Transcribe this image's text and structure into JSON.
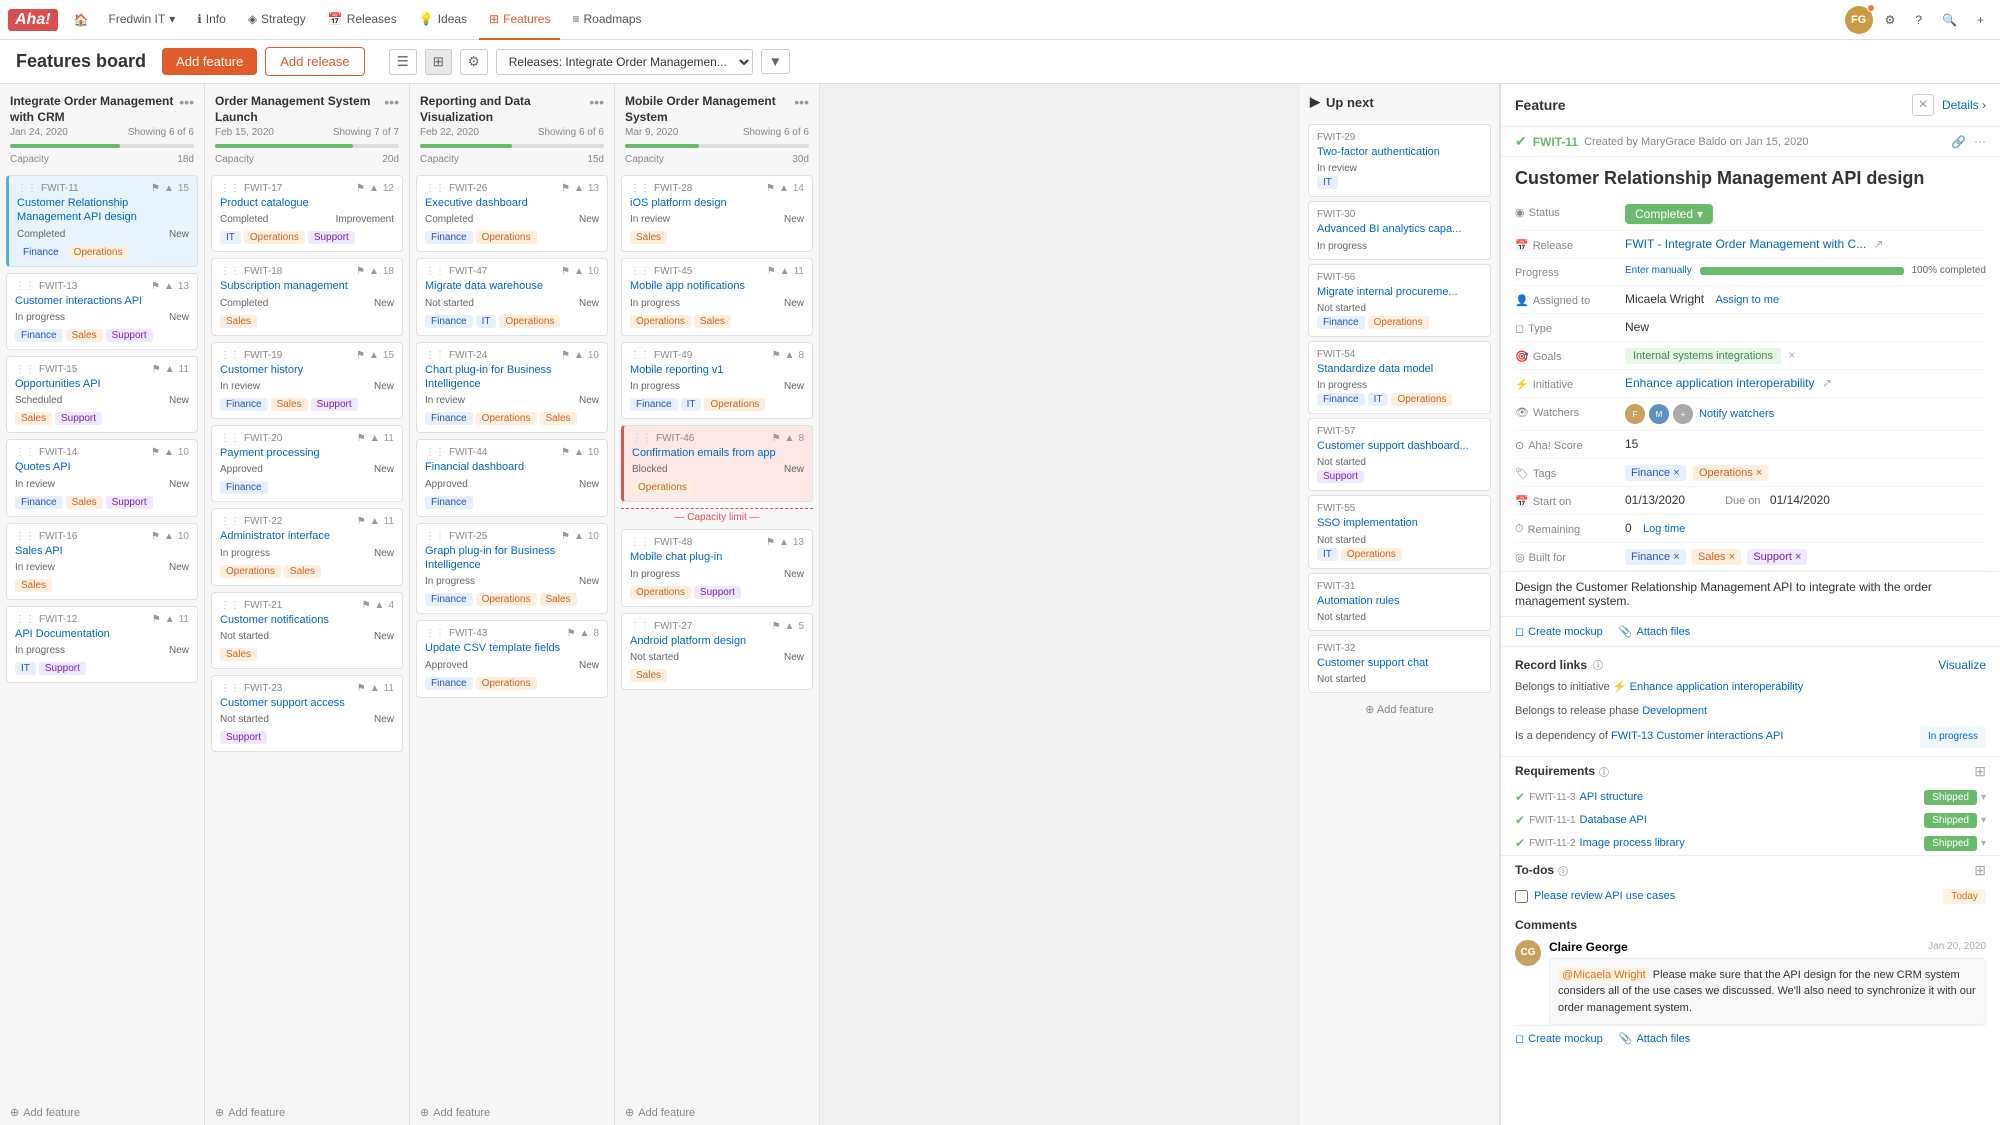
{
  "app": {
    "logo": "Aha!",
    "nav_items": [
      {
        "label": "Fredwin IT",
        "icon": "home",
        "dropdown": true
      },
      {
        "label": "Info",
        "icon": "info"
      },
      {
        "label": "Strategy",
        "icon": "strategy"
      },
      {
        "label": "Releases",
        "icon": "calendar"
      },
      {
        "label": "Ideas",
        "icon": "lightbulb"
      },
      {
        "label": "Features",
        "icon": "grid",
        "active": true
      },
      {
        "label": "Roadmaps",
        "icon": "roadmap"
      }
    ],
    "page_title": "Features board",
    "btn_add_feature": "Add feature",
    "btn_add_release": "Add release"
  },
  "filter": {
    "view_options": [
      "list",
      "grid",
      "settings"
    ],
    "release_filter": "Releases: Integrate Order Managemen...",
    "filter_icon": "filter"
  },
  "columns": [
    {
      "id": "col1",
      "title": "Integrate Order Management with CRM",
      "date": "Jan 24, 2020",
      "showing": "Showing 6 of 6",
      "capacity_label": "Capacity",
      "capacity_days": "18d",
      "progress": 60,
      "cards": [
        {
          "id": "FWIT-11",
          "title": "Customer Relationship Management API design",
          "status": "Completed",
          "status_label": "New",
          "tags": [
            "Finance",
            "Operations"
          ],
          "tag_styles": [
            "finance",
            "operations"
          ],
          "icons": "⚑▲",
          "count": 15,
          "highlighted": true
        },
        {
          "id": "FWIT-13",
          "title": "Customer interactions API",
          "status": "In progress",
          "status_label": "New",
          "tags": [
            "Finance",
            "Sales",
            "Support"
          ],
          "tag_styles": [
            "finance",
            "sales",
            "support"
          ],
          "icons": "▲",
          "count": 13
        },
        {
          "id": "FWIT-15",
          "title": "Opportunities API",
          "status": "Scheduled",
          "status_label": "New",
          "tags": [
            "Sales",
            "Support"
          ],
          "tag_styles": [
            "sales",
            "support"
          ],
          "icons": "⚑▲",
          "count": 11
        },
        {
          "id": "FWIT-14",
          "title": "Quotes API",
          "status": "In review",
          "status_label": "New",
          "tags": [
            "Finance",
            "Sales",
            "Support"
          ],
          "tag_styles": [
            "finance",
            "sales",
            "support"
          ],
          "icons": "▲",
          "count": 10
        },
        {
          "id": "FWIT-16",
          "title": "Sales API",
          "status": "In review",
          "status_label": "New",
          "tags": [
            "Sales"
          ],
          "tag_styles": [
            "sales"
          ],
          "icons": "▲",
          "count": 10
        },
        {
          "id": "FWIT-12",
          "title": "API Documentation",
          "status": "In progress",
          "status_label": "New",
          "tags": [
            "IT",
            "Support"
          ],
          "tag_styles": [
            "it",
            "support"
          ],
          "icons": "▲",
          "count": 11
        }
      ]
    },
    {
      "id": "col2",
      "title": "Order Management System Launch",
      "date": "Feb 15, 2020",
      "showing": "Showing 7 of 7",
      "capacity_label": "Capacity",
      "capacity_days": "20d",
      "progress": 75,
      "cards": [
        {
          "id": "FWIT-17",
          "title": "Product catalogue",
          "status": "Completed",
          "status_label": "Improvement",
          "tags": [
            "IT",
            "Operations",
            "Support"
          ],
          "tag_styles": [
            "it",
            "operations",
            "support"
          ],
          "icons": "▲",
          "count": 12
        },
        {
          "id": "FWIT-18",
          "title": "Subscription management",
          "status": "Completed",
          "status_label": "New",
          "tags": [
            "Sales"
          ],
          "tag_styles": [
            "sales"
          ],
          "icons": "▲",
          "count": 18
        },
        {
          "id": "FWIT-19",
          "title": "Customer history",
          "status": "In review",
          "status_label": "New",
          "tags": [
            "Finance",
            "Sales",
            "Support"
          ],
          "tag_styles": [
            "finance",
            "sales",
            "support"
          ],
          "icons": "▲",
          "count": 15
        },
        {
          "id": "FWIT-20",
          "title": "Payment processing",
          "status": "Approved",
          "status_label": "New",
          "tags": [
            "Finance"
          ],
          "tag_styles": [
            "finance"
          ],
          "icons": "▲",
          "count": 11
        },
        {
          "id": "FWIT-22",
          "title": "Administrator interface",
          "status": "In progress",
          "status_label": "New",
          "tags": [
            "Operations",
            "Sales"
          ],
          "tag_styles": [
            "operations",
            "sales"
          ],
          "icons": "▲",
          "count": 11
        },
        {
          "id": "FWIT-21",
          "title": "Customer notifications",
          "status": "Not started",
          "status_label": "New",
          "tags": [
            "Sales"
          ],
          "tag_styles": [
            "sales"
          ],
          "icons": "▲",
          "count": 4
        },
        {
          "id": "FWIT-23",
          "title": "Customer support access",
          "status": "Not started",
          "status_label": "New",
          "tags": [
            "Support"
          ],
          "tag_styles": [
            "support"
          ],
          "icons": "▲",
          "count": 11
        }
      ]
    },
    {
      "id": "col3",
      "title": "Reporting and Data Visualization",
      "date": "Feb 22, 2020",
      "showing": "Showing 6 of 6",
      "capacity_label": "Capacity",
      "capacity_days": "15d",
      "progress": 50,
      "cards": [
        {
          "id": "FWIT-26",
          "title": "Executive dashboard",
          "status": "Completed",
          "status_label": "New",
          "tags": [
            "Finance",
            "Operations"
          ],
          "tag_styles": [
            "finance",
            "operations"
          ],
          "icons": "▲",
          "count": 13
        },
        {
          "id": "FWIT-47",
          "title": "Migrate data warehouse",
          "status": "Not started",
          "status_label": "New",
          "tags": [
            "Finance",
            "IT",
            "Operations"
          ],
          "tag_styles": [
            "finance",
            "it",
            "operations"
          ],
          "icons": "▲",
          "count": 10
        },
        {
          "id": "FWIT-24",
          "title": "Chart plug-in for Business Intelligence",
          "status": "In review",
          "status_label": "New",
          "tags": [
            "Finance",
            "Operations",
            "Sales"
          ],
          "tag_styles": [
            "finance",
            "operations",
            "sales"
          ],
          "icons": "▲",
          "count": 10
        },
        {
          "id": "FWIT-44",
          "title": "Financial dashboard",
          "status": "Approved",
          "status_label": "New",
          "tags": [
            "Finance"
          ],
          "tag_styles": [
            "finance"
          ],
          "icons": "▲",
          "count": 10
        },
        {
          "id": "FWIT-25",
          "title": "Graph plug-in for Business Intelligence",
          "status": "In progress",
          "status_label": "New",
          "tags": [
            "Finance",
            "Operations",
            "Sales"
          ],
          "tag_styles": [
            "finance",
            "operations",
            "sales"
          ],
          "icons": "▲",
          "count": 10
        },
        {
          "id": "FWIT-43",
          "title": "Update CSV template fields",
          "status": "Approved",
          "status_label": "New",
          "tags": [
            "Finance",
            "Operations"
          ],
          "tag_styles": [
            "finance",
            "operations"
          ],
          "icons": "▲",
          "count": 8
        }
      ]
    },
    {
      "id": "col4",
      "title": "Mobile Order Management System",
      "date": "Mar 9, 2020",
      "showing": "Showing 6 of 6",
      "capacity_label": "Capacity",
      "capacity_days": "30d",
      "progress": 40,
      "cards": [
        {
          "id": "FWIT-28",
          "title": "iOS platform design",
          "status": "In review",
          "status_label": "New",
          "tags": [
            "Sales"
          ],
          "tag_styles": [
            "sales"
          ],
          "icons": "▲",
          "count": 14
        },
        {
          "id": "FWIT-45",
          "title": "Mobile app notifications",
          "status": "In progress",
          "status_label": "New",
          "tags": [
            "Operations",
            "Sales"
          ],
          "tag_styles": [
            "operations",
            "sales"
          ],
          "icons": "▲",
          "count": 11
        },
        {
          "id": "FWIT-49",
          "title": "Mobile reporting v1",
          "status": "In progress",
          "status_label": "New",
          "tags": [
            "Finance",
            "IT",
            "Operations"
          ],
          "tag_styles": [
            "finance",
            "it",
            "operations"
          ],
          "icons": "▲",
          "count": 8
        },
        {
          "id": "FWIT-46",
          "title": "Confirmation emails from app",
          "status": "Blocked",
          "status_label": "New",
          "tags": [
            "Operations"
          ],
          "tag_styles": [
            "operations"
          ],
          "icons": "▲",
          "count": 8,
          "highlighted_red": true
        },
        {
          "id": "FWIT-48",
          "title": "Mobile chat plug-in",
          "status": "In progress",
          "status_label": "New",
          "tags": [
            "Operations",
            "Support"
          ],
          "tag_styles": [
            "operations",
            "support"
          ],
          "icons": "▲",
          "count": 13,
          "capacity_limit": true
        },
        {
          "id": "FWIT-27",
          "title": "Android platform design",
          "status": "Not started",
          "status_label": "New",
          "tags": [
            "Sales"
          ],
          "tag_styles": [
            "sales"
          ],
          "icons": "▲",
          "count": 5
        }
      ]
    }
  ],
  "up_next": {
    "header": "Up next",
    "cards": [
      {
        "id": "FWIT-29",
        "title": "Two-factor authentication",
        "status": "In review",
        "tags": [
          "IT"
        ],
        "tag_styles": [
          "it"
        ]
      },
      {
        "id": "FWIT-30",
        "title": "Advanced BI analytics capa...",
        "status": "In progress",
        "tags": [],
        "tag_styles": []
      },
      {
        "id": "FWIT-56",
        "title": "Migrate internal procureme...",
        "status": "Not started",
        "tags": [
          "Finance",
          "Operations"
        ],
        "tag_styles": [
          "finance",
          "operations"
        ]
      },
      {
        "id": "FWIT-54",
        "title": "Standardize data model",
        "status": "In progress",
        "tags": [
          "Finance",
          "IT",
          "Operations"
        ],
        "tag_styles": [
          "finance",
          "it",
          "operations"
        ]
      },
      {
        "id": "FWIT-57",
        "title": "Customer support dashboard...",
        "status": "Not started",
        "tags": [
          "Support"
        ],
        "tag_styles": [
          "support"
        ]
      },
      {
        "id": "FWIT-55",
        "title": "SSO implementation",
        "status": "Not started",
        "tags": [
          "IT",
          "Operations"
        ],
        "tag_styles": [
          "it",
          "operations"
        ]
      },
      {
        "id": "FWIT-31",
        "title": "Automation rules",
        "status": "Not started",
        "tags": [],
        "tag_styles": []
      },
      {
        "id": "FWIT-32",
        "title": "Customer support chat",
        "status": "Not started",
        "tags": [],
        "tag_styles": []
      }
    ],
    "add_feature": "Add feature"
  },
  "detail": {
    "panel_title": "Feature",
    "close_label": "×",
    "details_label": "Details ›",
    "feature_id": "FWIT-11",
    "created_by": "Created by MaryGrace Baldo on Jan 15, 2020",
    "feature_title": "Customer Relationship Management API design",
    "status_label": "Status",
    "status_value": "Completed",
    "release_label": "Release",
    "release_value": "FWIT - Integrate Order Management with C...",
    "assigned_label": "Assigned to",
    "assigned_value": "Micaela Wright",
    "assign_me": "Assign to me",
    "goals_label": "Goals",
    "goals_value": "Internal systems integrations",
    "initiative_label": "Initiative",
    "initiative_value": "Enhance application interoperability",
    "type_label": "Type",
    "type_value": "New",
    "watchers_label": "Watchers",
    "notify_label": "Notify watchers",
    "aha_score_label": "Aha! Score",
    "aha_score": "15",
    "start_on_label": "Start on",
    "start_on": "01/13/2020",
    "due_on_label": "Due on",
    "due_on": "01/14/2020",
    "remaining_label": "Remaining",
    "log_time_label": "Log time",
    "remaining_value": "0",
    "built_for_label": "Built for",
    "built_for_tags": [
      "Finance",
      "Sales",
      "Support"
    ],
    "built_for_tag_styles": [
      "finance",
      "sales",
      "support"
    ],
    "progress_label": "Progress",
    "progress_enter": "Enter manually",
    "progress_value": 100,
    "progress_text": "100% completed",
    "description": "Design the Customer Relationship Management API to integrate with the order management system.",
    "create_mockup": "Create mockup",
    "attach_files": "Attach files",
    "record_links_label": "Record links",
    "visualize_label": "Visualize",
    "link1": "Belongs to initiative ⚡ Enhance application interoperability",
    "link2": "Belongs to release phase Development",
    "link3": "Is a dependency of FWIT-13 Customer interactions API",
    "link3_status": "In progress",
    "requirements_label": "Requirements",
    "requirements": [
      {
        "id": "FWIT-11-3",
        "title": "API structure",
        "status": "Shipped"
      },
      {
        "id": "FWIT-11-1",
        "title": "Database API",
        "status": "Shipped"
      },
      {
        "id": "FWIT-11-2",
        "title": "Image process library",
        "status": "Shipped"
      }
    ],
    "todos_label": "To-dos",
    "todo1": "Please review API use cases",
    "todo1_due": "Today",
    "comments_label": "Comments",
    "comment_author": "Claire George",
    "comment_date": "Jan 20, 2020",
    "comment_mention": "@Micaela Wright",
    "comment_text": "Please make sure that the API design for the new CRM system considers all of the use cases we discussed. We'll also need to synchronize it with our order management system.",
    "comment_create_mockup": "Create mockup",
    "comment_attach_files": "Attach files"
  }
}
